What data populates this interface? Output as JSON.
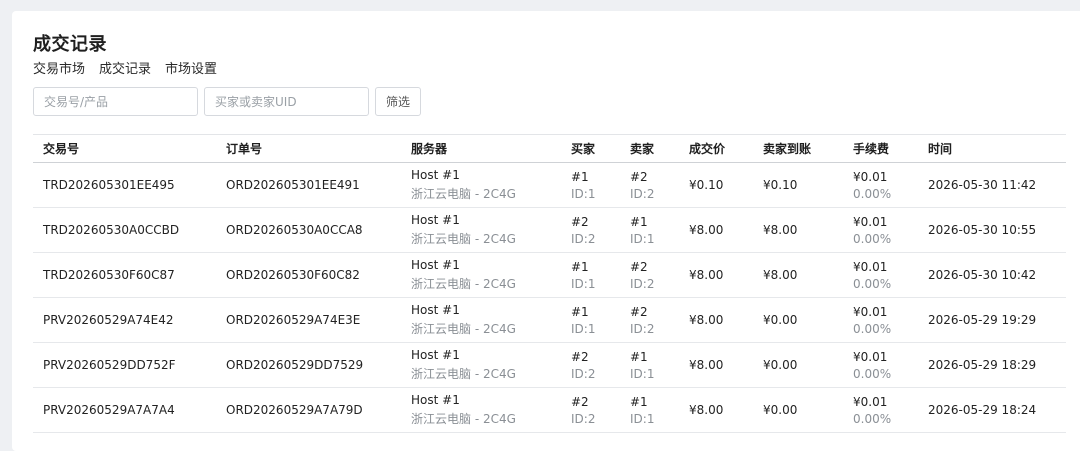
{
  "page": {
    "title": "成交记录",
    "nav": [
      "交易市场",
      "成交记录",
      "市场设置"
    ]
  },
  "filters": {
    "trade_placeholder": "交易号/产品",
    "uid_placeholder": "买家或卖家UID",
    "filter_label": "筛选"
  },
  "table": {
    "headers": [
      "交易号",
      "订单号",
      "服务器",
      "买家",
      "卖家",
      "成交价",
      "卖家到账",
      "手续费",
      "时间"
    ],
    "rows": [
      {
        "trade_no": "TRD202605301EE495",
        "order_no": "ORD202605301EE491",
        "server_name": "Host #1",
        "server_desc": "浙江云电脑 - 2C4G",
        "buyer": "#1",
        "buyer_id": "ID:1",
        "seller": "#2",
        "seller_id": "ID:2",
        "price": "¥0.10",
        "seller_receive": "¥0.10",
        "fee": "¥0.01",
        "fee_rate": "0.00%",
        "time": "2026-05-30 11:42"
      },
      {
        "trade_no": "TRD20260530A0CCBD",
        "order_no": "ORD20260530A0CCA8",
        "server_name": "Host #1",
        "server_desc": "浙江云电脑 - 2C4G",
        "buyer": "#2",
        "buyer_id": "ID:2",
        "seller": "#1",
        "seller_id": "ID:1",
        "price": "¥8.00",
        "seller_receive": "¥8.00",
        "fee": "¥0.01",
        "fee_rate": "0.00%",
        "time": "2026-05-30 10:55"
      },
      {
        "trade_no": "TRD20260530F60C87",
        "order_no": "ORD20260530F60C82",
        "server_name": "Host #1",
        "server_desc": "浙江云电脑 - 2C4G",
        "buyer": "#1",
        "buyer_id": "ID:1",
        "seller": "#2",
        "seller_id": "ID:2",
        "price": "¥8.00",
        "seller_receive": "¥8.00",
        "fee": "¥0.01",
        "fee_rate": "0.00%",
        "time": "2026-05-30 10:42"
      },
      {
        "trade_no": "PRV20260529A74E42",
        "order_no": "ORD20260529A74E3E",
        "server_name": "Host #1",
        "server_desc": "浙江云电脑 - 2C4G",
        "buyer": "#1",
        "buyer_id": "ID:1",
        "seller": "#2",
        "seller_id": "ID:2",
        "price": "¥8.00",
        "seller_receive": "¥0.00",
        "fee": "¥0.01",
        "fee_rate": "0.00%",
        "time": "2026-05-29 19:29"
      },
      {
        "trade_no": "PRV20260529DD752F",
        "order_no": "ORD20260529DD7529",
        "server_name": "Host #1",
        "server_desc": "浙江云电脑 - 2C4G",
        "buyer": "#2",
        "buyer_id": "ID:2",
        "seller": "#1",
        "seller_id": "ID:1",
        "price": "¥8.00",
        "seller_receive": "¥0.00",
        "fee": "¥0.01",
        "fee_rate": "0.00%",
        "time": "2026-05-29 18:29"
      },
      {
        "trade_no": "PRV20260529A7A7A4",
        "order_no": "ORD20260529A7A79D",
        "server_name": "Host #1",
        "server_desc": "浙江云电脑 - 2C4G",
        "buyer": "#2",
        "buyer_id": "ID:2",
        "seller": "#1",
        "seller_id": "ID:1",
        "price": "¥8.00",
        "seller_receive": "¥0.00",
        "fee": "¥0.01",
        "fee_rate": "0.00%",
        "time": "2026-05-29 18:24"
      }
    ]
  }
}
